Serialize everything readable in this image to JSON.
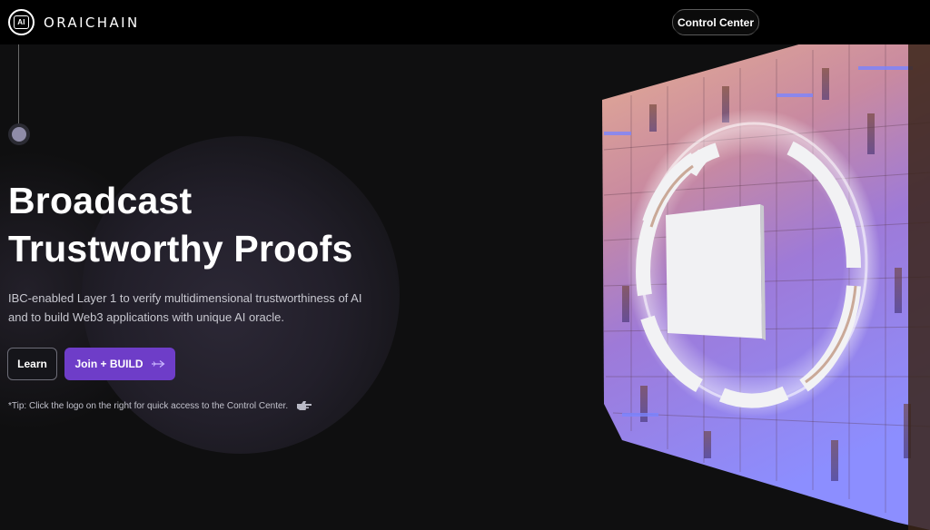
{
  "header": {
    "logo_mark": "AI",
    "brand": "ORAICHAIN",
    "control_center_label": "Control Center"
  },
  "hero": {
    "title_line1": "Broadcast",
    "title_line2": "Trustworthy Proofs",
    "description": "IBC-enabled Layer 1 to verify multidimensional trustworthiness of AI and to build Web3 applications with unique AI oracle.",
    "learn_label": "Learn",
    "join_label": "Join + BUILD",
    "tip": "*Tip: Click the logo on the right for quick access to the Control Center."
  },
  "icons": {
    "arrow": "arrow-right-icon",
    "hand": "pointing-hand-icon",
    "logo": "oraichain-logo-icon"
  },
  "colors": {
    "accent": "#6e3dc8",
    "background": "#0f0f10",
    "header": "#000000"
  }
}
